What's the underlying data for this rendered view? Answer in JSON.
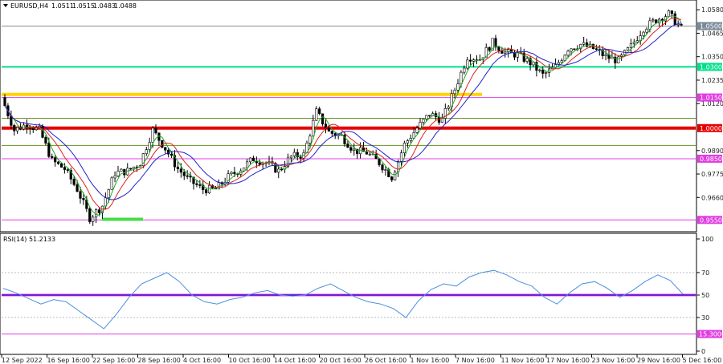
{
  "chart_data": [
    {
      "type": "candlestick",
      "title": "EURUSD,H4",
      "ohlc_header": [
        "1.0511",
        "1.0515",
        "1.0483",
        "1.0488"
      ],
      "y_ticks": [
        "1.0580",
        "1.0465",
        "1.0350",
        "1.0235",
        "1.0120",
        "0.9890",
        "0.9775",
        "0.9660"
      ],
      "current_price_label": "1.0500",
      "levels": [
        {
          "label": "1.0300",
          "value": 1.03,
          "color": "#00e08a"
        },
        {
          "label": "1.0150",
          "value": 1.015,
          "color": "#e13ce1"
        },
        {
          "label": "1.0000",
          "value": 1.0,
          "color": "#e60000"
        },
        {
          "label": "0.9850",
          "value": 0.985,
          "color": "#e13ce1"
        },
        {
          "label": "0.9550",
          "value": 0.955,
          "color": "#e13ce1"
        }
      ],
      "highlight_lines": [
        {
          "value": 1.0165,
          "color": "#ffd400",
          "from": "12 Sep 2022",
          "to": "8 Nov 2022"
        },
        {
          "value": 0.9552,
          "color": "#44dd44",
          "from": "26 Sep 2022",
          "to": "27 Sep 2022"
        }
      ],
      "extra_lines": [
        1.0048,
        0.9915
      ],
      "series_close": [
        {
          "date": "12 Sep",
          "close": 1.015
        },
        {
          "date": "14 Sep",
          "close": 0.999
        },
        {
          "date": "16 Sep",
          "close": 1.002
        },
        {
          "date": "19 Sep",
          "close": 0.999
        },
        {
          "date": "21 Sep",
          "close": 0.984
        },
        {
          "date": "22 Sep",
          "close": 0.98
        },
        {
          "date": "23 Sep",
          "close": 0.97
        },
        {
          "date": "26 Sep",
          "close": 0.956
        },
        {
          "date": "28 Sep",
          "close": 0.962
        },
        {
          "date": "29 Sep",
          "close": 0.978
        },
        {
          "date": "30 Sep",
          "close": 0.979
        },
        {
          "date": "3 Oct",
          "close": 0.983
        },
        {
          "date": "4 Oct",
          "close": 0.999
        },
        {
          "date": "5 Oct",
          "close": 0.99
        },
        {
          "date": "6 Oct",
          "close": 0.98
        },
        {
          "date": "7 Oct",
          "close": 0.974
        },
        {
          "date": "10 Oct",
          "close": 0.97
        },
        {
          "date": "12 Oct",
          "close": 0.97
        },
        {
          "date": "13 Oct",
          "close": 0.976
        },
        {
          "date": "14 Oct",
          "close": 0.98
        },
        {
          "date": "17 Oct",
          "close": 0.985
        },
        {
          "date": "18 Oct",
          "close": 0.983
        },
        {
          "date": "20 Oct",
          "close": 0.979
        },
        {
          "date": "21 Oct",
          "close": 0.986
        },
        {
          "date": "24 Oct",
          "close": 0.987
        },
        {
          "date": "26 Oct",
          "close": 1.008
        },
        {
          "date": "27 Oct",
          "close": 0.998
        },
        {
          "date": "28 Oct",
          "close": 0.996
        },
        {
          "date": "31 Oct",
          "close": 0.989
        },
        {
          "date": "1 Nov",
          "close": 0.988
        },
        {
          "date": "2 Nov",
          "close": 0.983
        },
        {
          "date": "3 Nov",
          "close": 0.976
        },
        {
          "date": "4 Nov",
          "close": 0.992
        },
        {
          "date": "7 Nov",
          "close": 1.0
        },
        {
          "date": "8 Nov",
          "close": 1.007
        },
        {
          "date": "9 Nov",
          "close": 1.004
        },
        {
          "date": "10 Nov",
          "close": 1.019
        },
        {
          "date": "11 Nov",
          "close": 1.035
        },
        {
          "date": "14 Nov",
          "close": 1.034
        },
        {
          "date": "15 Nov",
          "close": 1.042
        },
        {
          "date": "16 Nov",
          "close": 1.037
        },
        {
          "date": "17 Nov",
          "close": 1.036
        },
        {
          "date": "18 Nov",
          "close": 1.032
        },
        {
          "date": "21 Nov",
          "close": 1.026
        },
        {
          "date": "22 Nov",
          "close": 1.03
        },
        {
          "date": "23 Nov",
          "close": 1.039
        },
        {
          "date": "24 Nov",
          "close": 1.041
        },
        {
          "date": "25 Nov",
          "close": 1.039
        },
        {
          "date": "28 Nov",
          "close": 1.035
        },
        {
          "date": "29 Nov",
          "close": 1.033
        },
        {
          "date": "30 Nov",
          "close": 1.04
        },
        {
          "date": "1 Dec",
          "close": 1.049
        },
        {
          "date": "2 Dec",
          "close": 1.053
        },
        {
          "date": "5 Dec",
          "close": 1.056
        },
        {
          "date": "5 Dec b",
          "close": 1.0488
        }
      ],
      "ylim": [
        0.95,
        1.062
      ]
    },
    {
      "type": "line",
      "title": "RSI(14) 51.2133",
      "y_ticks": [
        "100",
        "70",
        "50",
        "30",
        "0"
      ],
      "level_line": {
        "label": "15.3000",
        "value": 15.3,
        "color": "#e13ce1"
      },
      "mid_line": {
        "value": 50,
        "color": "#0000cc"
      },
      "values": [
        56,
        52,
        47,
        42,
        46,
        44,
        36,
        28,
        20,
        33,
        48,
        60,
        65,
        70,
        62,
        50,
        44,
        42,
        46,
        48,
        52,
        54,
        50,
        49,
        50,
        56,
        60,
        54,
        48,
        44,
        42,
        38,
        30,
        45,
        55,
        60,
        58,
        66,
        70,
        72,
        68,
        62,
        58,
        48,
        42,
        52,
        60,
        62,
        56,
        48,
        54,
        62,
        68,
        63,
        51
      ],
      "ylim": [
        0,
        100
      ]
    }
  ],
  "x_ticks": [
    "12 Sep 2022",
    "16 Sep 16:00",
    "22 Sep 16:00",
    "28 Sep 16:00",
    "4 Oct 16:00",
    "10 Oct 16:00",
    "14 Oct 16:00",
    "20 Oct 16:00",
    "26 Oct 16:00",
    "1 Nov 16:00",
    "7 Nov 16:00",
    "11 Nov 16:00",
    "17 Nov 16:00",
    "23 Nov 16:00",
    "29 Nov 16:00",
    "5 Dec 16:00"
  ],
  "colors": {
    "up_candle": "#000000",
    "ma_fast": "#22aa22",
    "ma_mid": "#dd2222",
    "ma_slow": "#2222cc",
    "rsi_line": "#4a90e2"
  }
}
